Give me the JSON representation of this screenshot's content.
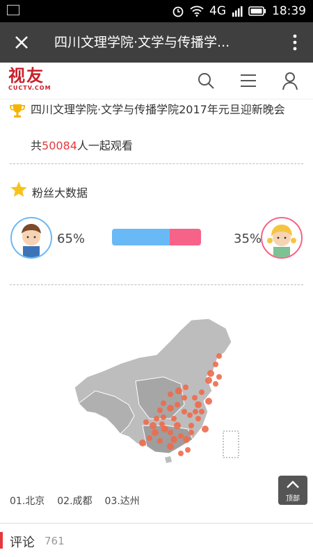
{
  "status_bar": {
    "network": "4G",
    "time": "18:39"
  },
  "app_bar": {
    "title": "四川文理学院·文学与传播学..."
  },
  "site": {
    "logo_cn": "视友",
    "logo_en": "CUCTV.COM"
  },
  "event": {
    "title": "四川文理学院·文学与传播学院2017年元旦迎新晚会",
    "viewers_prefix": "共",
    "viewers_count": "50084",
    "viewers_suffix": "人一起观看"
  },
  "fans": {
    "title": "粉丝大数据",
    "male_percent_label": "65%",
    "female_percent_label": "35%",
    "male_share": 0.65,
    "female_share": 0.35,
    "colors": {
      "male": "#6ab9f7",
      "female": "#f76288"
    }
  },
  "map": {
    "top_cities": [
      "01.北京",
      "02.成都",
      "03.达州"
    ],
    "dot_color": "#ee6a4b"
  },
  "top_button": {
    "label": "顶部"
  },
  "comments": {
    "label": "评论",
    "count": "761"
  }
}
